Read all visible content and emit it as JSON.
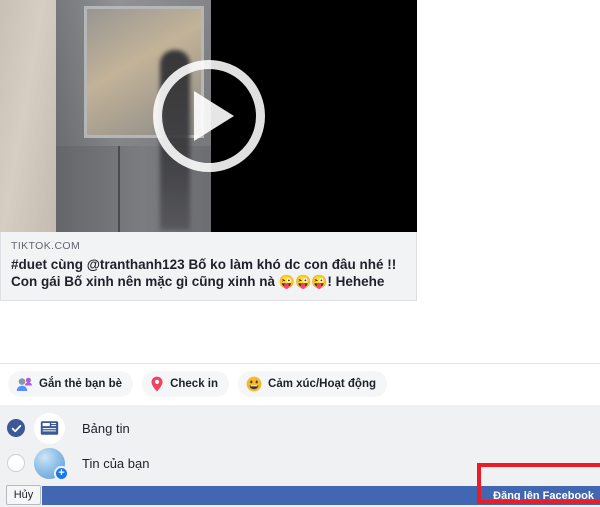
{
  "preview": {
    "domain": "TIKTOK.COM",
    "title_line1": "#duet cùng @tranthanh123 Bố ko làm khó dc con đâu nhé !! Con",
    "title_line2_pre": "gái Bố xinh nên mặc gì cũng xinh nà ",
    "title_emojis": "😜😜😜",
    "title_line2_post": "! Hehehe",
    "play_icon": "play-icon"
  },
  "chips": [
    {
      "label": "Gắn thẻ bạn bè",
      "icon": "tag-friends-icon"
    },
    {
      "label": "Check in",
      "icon": "location-pin-icon"
    },
    {
      "label": "Cảm xúc/Hoạt động",
      "icon": "smiley-feeling-icon"
    }
  ],
  "destinations": [
    {
      "label": "Bảng tin",
      "selected": true,
      "icon": "news-feed-icon"
    },
    {
      "label": "Tin của bạn",
      "selected": false,
      "icon": "story-avatar-icon",
      "badge": "+"
    }
  ],
  "bottom": {
    "cancel_label": "Hủy",
    "post_label": "Đăng lên Facebook"
  },
  "colors": {
    "facebook_blue": "#4267B2",
    "radio_blue": "#3B5998",
    "annotation_red": "#ED1C24",
    "panel_grey": "#F0F1F3",
    "card_grey": "#F2F3F5"
  }
}
